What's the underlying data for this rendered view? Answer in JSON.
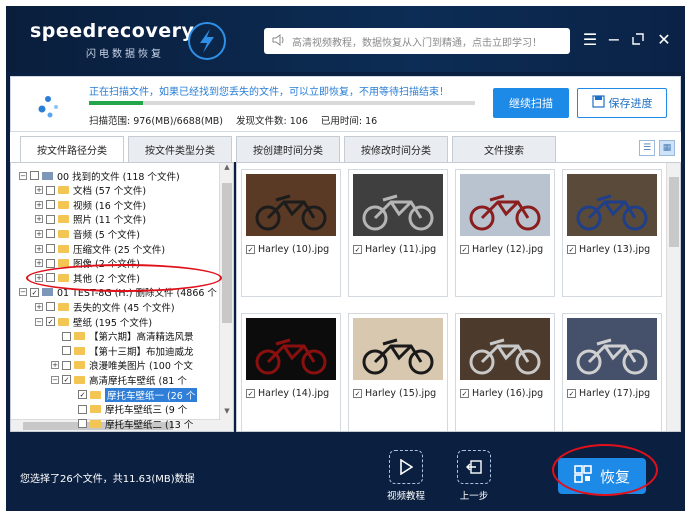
{
  "app": {
    "logo_text": "speedrecovery",
    "logo_sub": "闪电数据恢复",
    "search_placeholder": "高清视频教程，数据恢复从入门到精通，点击立即学习！"
  },
  "scan": {
    "message": "正在扫描文件，如果已经找到您丢失的文件，可以立即恢复，不用等待扫描结束！",
    "progress_fraction": 0.14,
    "range_label": "扫描范围: 976(MB)/6688(MB)",
    "found_label": "发现文件数: 106",
    "time_label": "已用时间: 16",
    "continue_label": "继续扫描",
    "save_label": "保存进度"
  },
  "tabs": [
    "按文件路径分类",
    "按文件类型分类",
    "按创建时间分类",
    "按修改时间分类",
    "文件搜索"
  ],
  "tree": [
    {
      "pm": "−",
      "icon": "drive",
      "label": "00 找到的文件 (118 个文件)",
      "indent": 0,
      "checked": false
    },
    {
      "pm": "+",
      "icon": "folder",
      "label": "文档 (57 个文件)",
      "indent": 1,
      "checked": false
    },
    {
      "pm": "+",
      "icon": "folder",
      "label": "视频 (16 个文件)",
      "indent": 1,
      "checked": false
    },
    {
      "pm": "+",
      "icon": "folder",
      "label": "照片 (11 个文件)",
      "indent": 1,
      "checked": false
    },
    {
      "pm": "+",
      "icon": "folder",
      "label": "音频 (5 个文件)",
      "indent": 1,
      "checked": false
    },
    {
      "pm": "+",
      "icon": "folder",
      "label": "压缩文件 (25 个文件)",
      "indent": 1,
      "checked": false
    },
    {
      "pm": "+",
      "icon": "folder",
      "label": "图像 (2 个文件)",
      "indent": 1,
      "checked": false
    },
    {
      "pm": "+",
      "icon": "folder",
      "label": "其他 (2 个文件)",
      "indent": 1,
      "checked": false
    },
    {
      "pm": "−",
      "icon": "drive",
      "label": "01 TEST-8G (H:) 删除文件 (4866 个",
      "indent": 0,
      "checked": true
    },
    {
      "pm": "+",
      "icon": "folder",
      "label": "丢失的文件 (45 个文件)",
      "indent": 1,
      "checked": false
    },
    {
      "pm": "−",
      "icon": "folder",
      "label": "壁纸 (195 个文件)",
      "indent": 1,
      "checked": true
    },
    {
      "pm": "",
      "icon": "folder",
      "label": "【第六期】高清精选风景",
      "indent": 2,
      "checked": false
    },
    {
      "pm": "",
      "icon": "folder",
      "label": "【第十三期】布加迪威龙",
      "indent": 2,
      "checked": false
    },
    {
      "pm": "+",
      "icon": "folder",
      "label": "浪漫唯美图片 (100 个文",
      "indent": 2,
      "checked": false
    },
    {
      "pm": "−",
      "icon": "folder",
      "label": "高清摩托车壁纸 (81 个",
      "indent": 2,
      "checked": true
    },
    {
      "pm": "",
      "icon": "folder",
      "label": "摩托车壁纸一 (26 个",
      "indent": 3,
      "checked": true,
      "selected": true
    },
    {
      "pm": "",
      "icon": "folder",
      "label": "摩托车壁纸三 (9 个",
      "indent": 3,
      "checked": false
    },
    {
      "pm": "",
      "icon": "folder",
      "label": "摩托车壁纸二 (13 个",
      "indent": 3,
      "checked": false
    }
  ],
  "files": [
    {
      "name": "Harley (10).jpg",
      "bg": "#5a3a24",
      "fg": "#1c1c1c"
    },
    {
      "name": "Harley (11).jpg",
      "bg": "#3f3f3f",
      "fg": "#b5b5b5"
    },
    {
      "name": "Harley (12).jpg",
      "bg": "#b9c3cf",
      "fg": "#8a1d1d"
    },
    {
      "name": "Harley (13).jpg",
      "bg": "#5a4a3a",
      "fg": "#1f3f8a"
    },
    {
      "name": "Harley (14).jpg",
      "bg": "#0c0c0c",
      "fg": "#8a1010"
    },
    {
      "name": "Harley (15).jpg",
      "bg": "#d8c8b0",
      "fg": "#1a1a1a"
    },
    {
      "name": "Harley (16).jpg",
      "bg": "#4c3a2c",
      "fg": "#c9c9c9"
    },
    {
      "name": "Harley (17).jpg",
      "bg": "#45506a",
      "fg": "#d0d0d0"
    }
  ],
  "footer": {
    "selection_info": "您选择了26个文件，共11.63(MB)数据",
    "video_label": "视频教程",
    "back_label": "上一步",
    "recover_label": "恢复"
  }
}
